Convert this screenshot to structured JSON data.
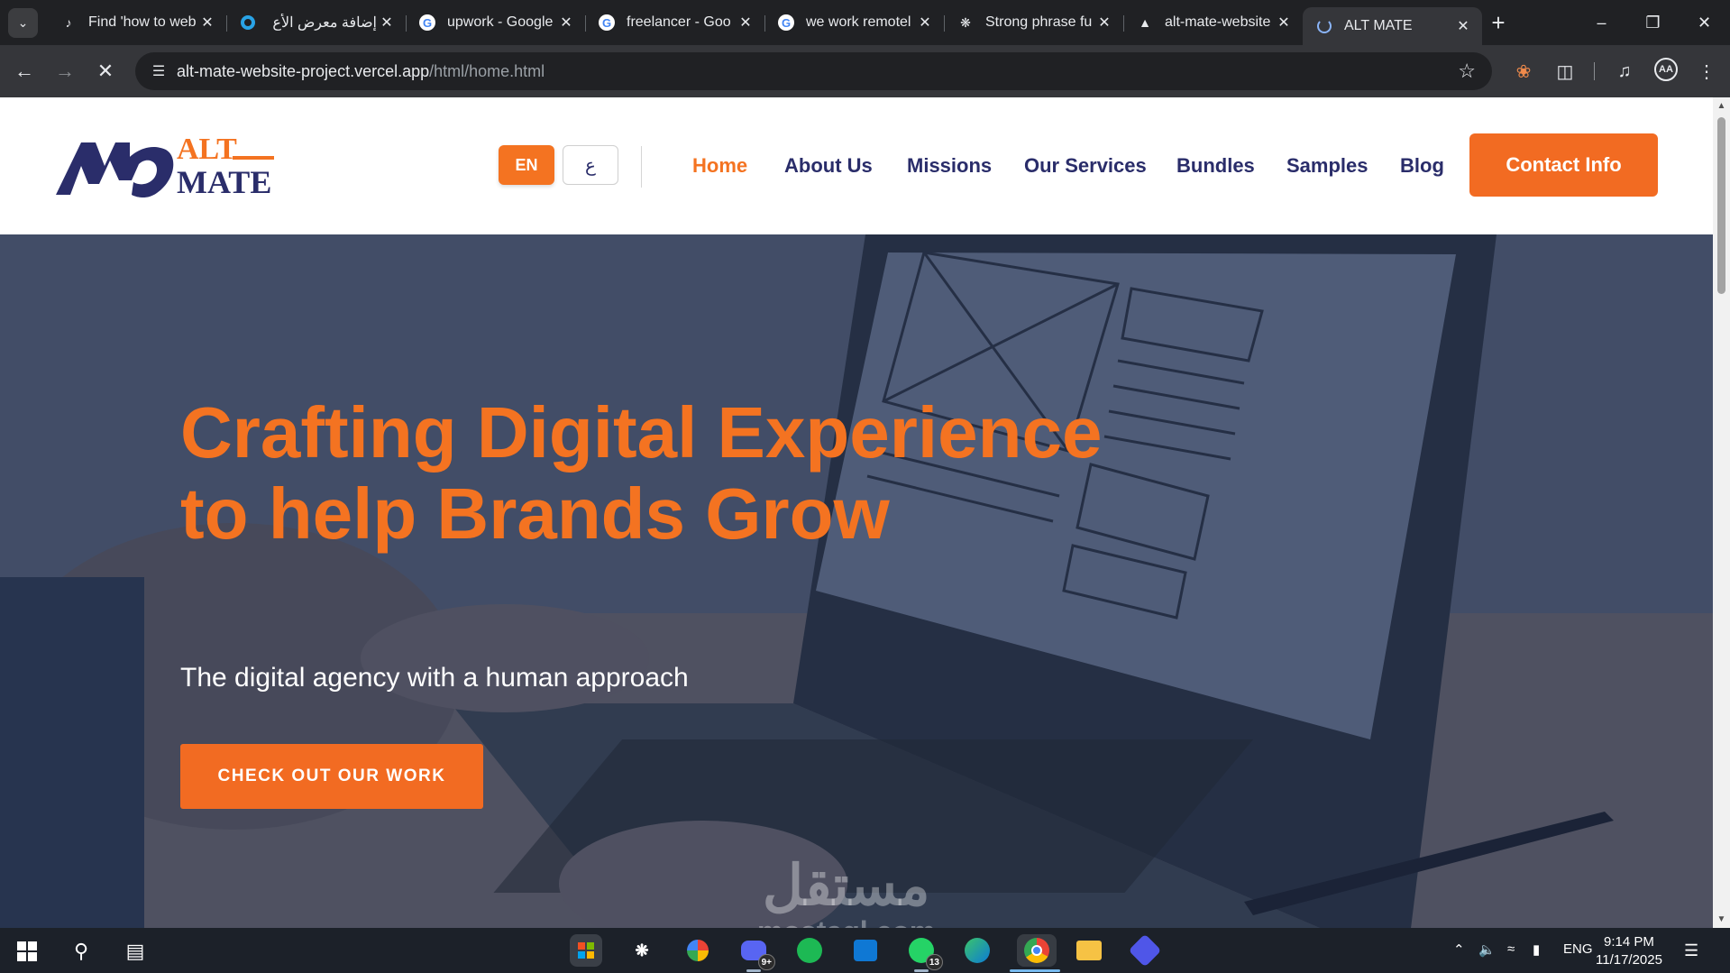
{
  "browser": {
    "tabs": [
      {
        "title": "Find 'how to web",
        "icon": "tiktok-icon"
      },
      {
        "title": "إضافة معرض الأع",
        "icon": "mostaql-icon"
      },
      {
        "title": "upwork - Google",
        "icon": "google-icon"
      },
      {
        "title": "freelancer - Goo",
        "icon": "google-icon"
      },
      {
        "title": "we work remotel",
        "icon": "google-icon"
      },
      {
        "title": "Strong phrase fu",
        "icon": "chatgpt-icon"
      },
      {
        "title": "alt-mate-website",
        "icon": "vercel-icon"
      },
      {
        "title": "ALT MATE",
        "icon": "loading-icon",
        "active": true
      }
    ],
    "url_host": "alt-mate-website-project.vercel.app",
    "url_path": "/html/home.html"
  },
  "site": {
    "logo": {
      "line1": "ALT",
      "line2": "MATE"
    },
    "lang": {
      "en": "EN",
      "ar": "ع"
    },
    "nav": [
      "Home",
      "About Us",
      "Missions",
      "Our Services",
      "Bundles",
      "Samples",
      "Blog"
    ],
    "nav_active": "Home",
    "contact_label": "Contact Info",
    "hero": {
      "title": "Crafting Digital Experience to help Brands Grow",
      "subtitle": "The digital agency with a human approach",
      "cta": "CHECK OUT OUR WORK"
    },
    "watermark": {
      "arabic": "مستقل",
      "latin": "mostaql.com"
    },
    "colors": {
      "accent": "#f47321",
      "brand_navy": "#2a2d6a"
    }
  },
  "taskbar": {
    "whatsapp_badge": "13",
    "discord_badge": "9+",
    "language": "ENG",
    "time": "9:14 PM",
    "date": "11/17/2025"
  }
}
